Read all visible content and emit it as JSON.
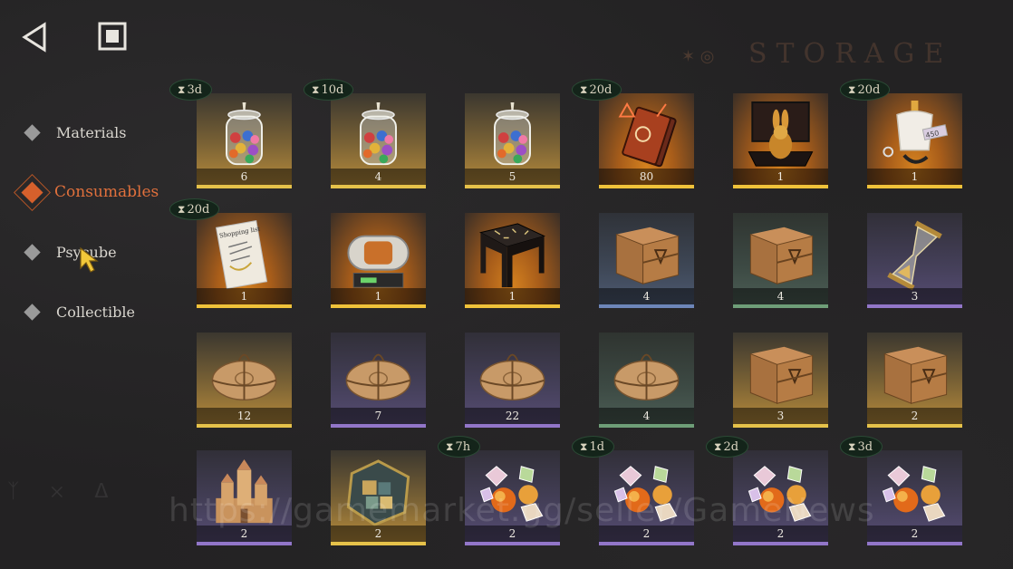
{
  "page": {
    "title": "STORAGE",
    "watermark": "https://gamemarket.gg/seller/GameNews"
  },
  "toolbar": {
    "back_icon": "back-triangle-icon",
    "stop_icon": "stop-square-icon"
  },
  "sidebar": {
    "items": [
      {
        "label": "Materials",
        "active": false
      },
      {
        "label": "Consumables",
        "active": true
      },
      {
        "label": "Psycube",
        "active": false
      },
      {
        "label": "Collectible",
        "active": false
      }
    ]
  },
  "items": [
    {
      "name": "candy-jar",
      "count": "6",
      "timer": "3d",
      "rarity": "gold"
    },
    {
      "name": "candy-jar",
      "count": "4",
      "timer": "10d",
      "rarity": "gold"
    },
    {
      "name": "candy-jar",
      "count": "5",
      "timer": "",
      "rarity": "gold"
    },
    {
      "name": "rune-book",
      "count": "80",
      "timer": "20d",
      "rarity": "orange"
    },
    {
      "name": "golden-rabbit-box",
      "count": "1",
      "timer": "",
      "rarity": "orange"
    },
    {
      "name": "tailor-mannequin",
      "count": "1",
      "timer": "20d",
      "rarity": "orange"
    },
    {
      "name": "shopping-list-ticket",
      "count": "1",
      "timer": "20d",
      "rarity": "orange"
    },
    {
      "name": "capsule-machine",
      "count": "1",
      "timer": "",
      "rarity": "orange"
    },
    {
      "name": "rune-table",
      "count": "1",
      "timer": "",
      "rarity": "orange"
    },
    {
      "name": "wooden-crate",
      "count": "4",
      "timer": "",
      "rarity": "blue"
    },
    {
      "name": "wooden-crate",
      "count": "4",
      "timer": "",
      "rarity": "green"
    },
    {
      "name": "hourglass",
      "count": "3",
      "timer": "",
      "rarity": "purple"
    },
    {
      "name": "parcel",
      "count": "12",
      "timer": "",
      "rarity": "gold"
    },
    {
      "name": "parcel",
      "count": "7",
      "timer": "",
      "rarity": "purple"
    },
    {
      "name": "parcel",
      "count": "22",
      "timer": "",
      "rarity": "purple"
    },
    {
      "name": "parcel",
      "count": "4",
      "timer": "",
      "rarity": "green"
    },
    {
      "name": "wooden-crate",
      "count": "3",
      "timer": "",
      "rarity": "gold"
    },
    {
      "name": "wooden-crate",
      "count": "2",
      "timer": "",
      "rarity": "gold"
    },
    {
      "name": "sandcastle",
      "count": "2",
      "timer": "",
      "rarity": "purple"
    },
    {
      "name": "hexagon-puzzle",
      "count": "2",
      "timer": "",
      "rarity": "gold"
    },
    {
      "name": "candies",
      "count": "2",
      "timer": "7h",
      "rarity": "purple"
    },
    {
      "name": "candies",
      "count": "2",
      "timer": "1d",
      "rarity": "purple"
    },
    {
      "name": "candies",
      "count": "2",
      "timer": "2d",
      "rarity": "purple"
    },
    {
      "name": "candies",
      "count": "2",
      "timer": "3d",
      "rarity": "purple"
    }
  ],
  "colors": {
    "accent": "#d6602c",
    "timer_bg": "#14241a"
  }
}
